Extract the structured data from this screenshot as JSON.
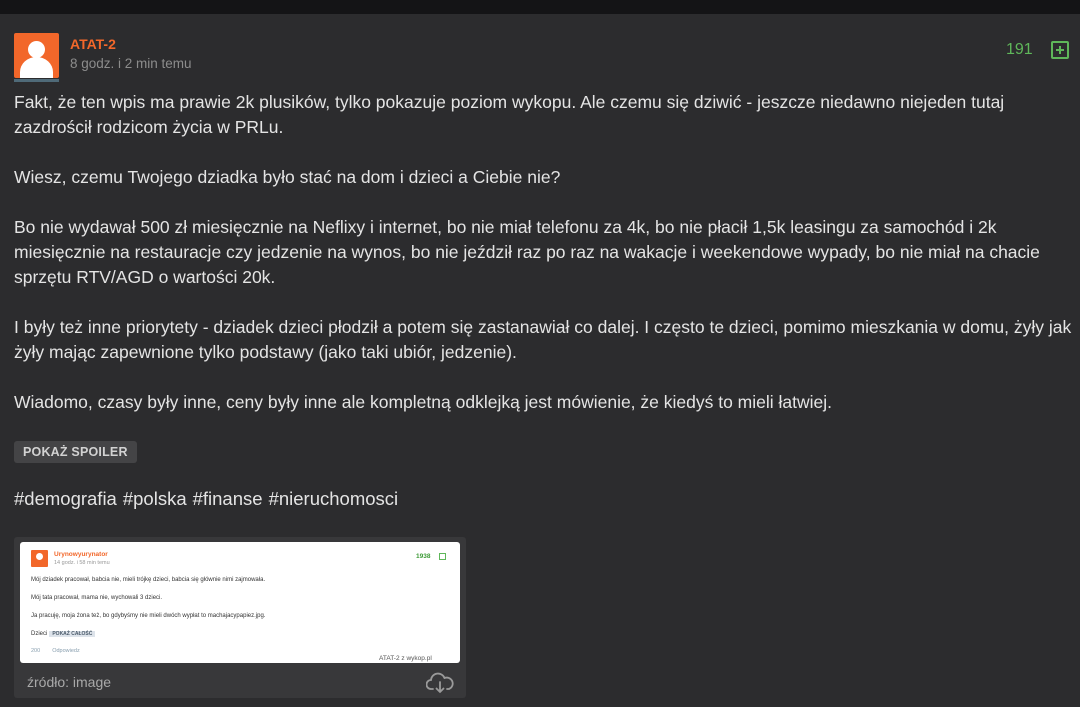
{
  "author": "ATAT-2",
  "time": "8 godz. i 2 min temu",
  "votes": "191",
  "paragraphs": [
    "Fakt, że ten wpis ma prawie 2k plusików, tylko pokazuje poziom wykopu. Ale czemu się dziwić - jeszcze niedawno niejeden tutaj zazdrościł rodzicom życia w PRLu.",
    "Wiesz, czemu Twojego dziadka było stać na dom i dzieci a Ciebie nie?",
    "Bo nie wydawał 500 zł miesięcznie na Neflixy i internet, bo nie miał telefonu za 4k, bo nie płacił 1,5k leasingu za samochód i 2k miesięcznie na restauracje czy jedzenie na wynos, bo nie jeździł raz po raz na wakacje i weekendowe wypady, bo nie miał na chacie sprzętu RTV/AGD o wartości 20k.",
    "I były też inne priorytety - dziadek dzieci płodził a potem się zastanawiał co dalej. I często te dzieci, pomimo mieszkania w domu, żyły jak żyły mając zapewnione tylko podstawy (jako taki ubiór, jedzenie).",
    "Wiadomo, czasy były inne, ceny były inne ale kompletną odklejką jest mówienie, że kiedyś to mieli łatwiej."
  ],
  "spoiler_label": "POKAŻ SPOILER",
  "tags": [
    "#demografia",
    "#polska",
    "#finanse",
    "#nieruchomosci"
  ],
  "embed": {
    "author": "Urynowyurynator",
    "time": "14 godz. i 58 min temu",
    "votes": "1938",
    "lines": [
      "Mój dziadek pracował, babcia nie, mieli trójkę dzieci, babcia się głównie nimi zajmowała.",
      "Mój tata pracował, mama nie, wychowali 3 dzieci.",
      "Ja pracuję, moja żona też, bo gdybyśmy nie mieli dwóch wypłat to machajacypapiez.jpg.",
      "Dzieci"
    ],
    "spoiler_label": "POKAŻ CAŁOŚĆ",
    "footer_count": "200",
    "footer_reply": "Odpowiedz",
    "source": "ATAT-2 z",
    "site": "wykop.pl"
  },
  "source_label": "źródło: image",
  "colors": {
    "accent": "#f2672a",
    "vote": "#5fb75a",
    "background": "#2c2c2e"
  }
}
